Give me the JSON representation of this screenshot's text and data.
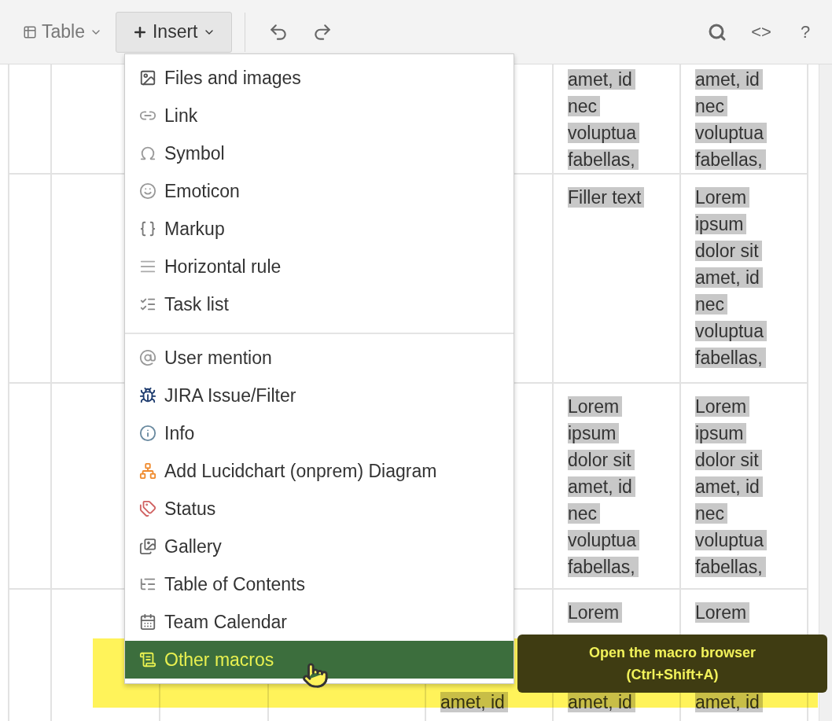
{
  "toolbar": {
    "table_button": {
      "label": "Table"
    },
    "insert_button": {
      "label": "Insert",
      "expanded": true
    },
    "code_button": {
      "label": "<>"
    },
    "help_button": {
      "label": "?"
    }
  },
  "table": {
    "rows": [
      {
        "column_6": [
          "amet, id nec voluptua fabellas,"
        ],
        "column_7": [
          "amet, id nec voluptua fabellas,"
        ]
      },
      {
        "column_6": [
          "Filler text"
        ],
        "column_7": [
          "Lorem ipsum dolor sit amet, id nec voluptua fabellas,"
        ]
      },
      {
        "column_6": [
          "Lorem ipsum dolor sit amet, id nec voluptua fabellas,"
        ],
        "column_7": [
          "Lorem ipsum dolor sit amet, id nec voluptua fabellas,"
        ]
      },
      {
        "column_5": [
          "amet, id"
        ],
        "column_6": [
          "Lorem",
          "amet, id"
        ],
        "column_7": [
          "Lorem",
          "amet, id"
        ]
      }
    ]
  },
  "insert_menu": {
    "sections": [
      {
        "items": [
          {
            "label": "Files and images",
            "selected": false
          },
          {
            "label": "Link",
            "selected": false
          },
          {
            "label": "Symbol",
            "selected": false
          },
          {
            "label": "Emoticon",
            "selected": false
          },
          {
            "label": "Markup",
            "selected": false
          },
          {
            "label": "Horizontal rule",
            "selected": false
          },
          {
            "label": "Task list",
            "selected": false
          }
        ]
      },
      {
        "items": [
          {
            "label": "User mention",
            "selected": false
          },
          {
            "label": "JIRA Issue/Filter",
            "selected": false
          },
          {
            "label": "Info",
            "selected": false
          },
          {
            "label": "Add Lucidchart (onprem) Diagram",
            "selected": false
          },
          {
            "label": "Status",
            "selected": false
          },
          {
            "label": "Gallery",
            "selected": false
          },
          {
            "label": "Table of Contents",
            "selected": false
          },
          {
            "label": "Team Calendar",
            "selected": false
          },
          {
            "label": "Other macros",
            "selected": true
          }
        ]
      }
    ]
  },
  "tooltip": {
    "text": "Open the macro browser (Ctrl+Shift+A)"
  }
}
